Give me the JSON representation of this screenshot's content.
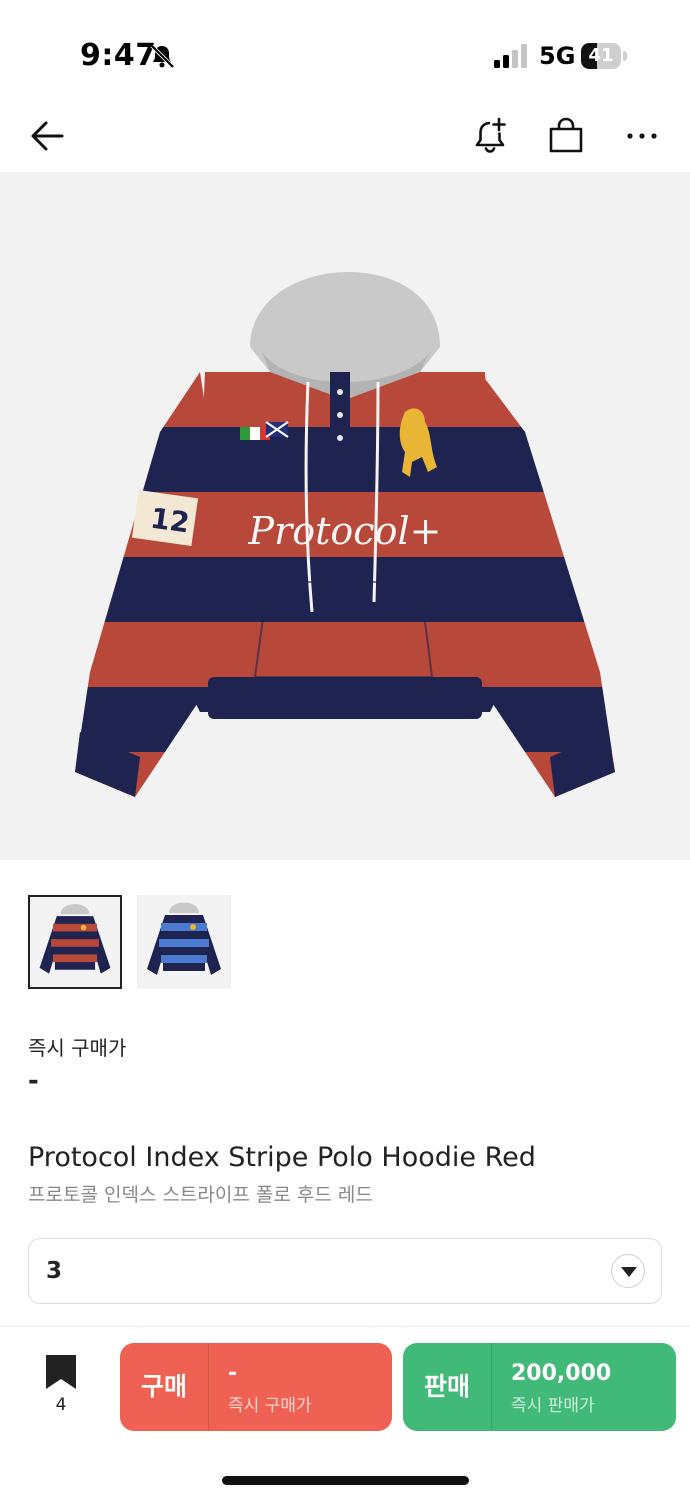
{
  "status_bar": {
    "time": "9:47",
    "network": "5G",
    "battery_level": "41",
    "battery_fraction": 0.41
  },
  "nav": {
    "icons": [
      "back-arrow-icon",
      "bell-plus-icon",
      "shopping-bag-icon",
      "more-dots-icon"
    ]
  },
  "product": {
    "main_image_subject": "red and navy striped hoodie",
    "thumbnails": [
      {
        "variant": "red",
        "selected": true
      },
      {
        "variant": "blue",
        "selected": false
      }
    ],
    "instant_buy_label": "즉시 구매가",
    "instant_buy_price": "-",
    "name_en": "Protocol Index Stripe Polo Hoodie Red",
    "name_ko": "프로토콜 인덱스 스트라이프 폴로 후드 레드",
    "size": "3"
  },
  "bottom_bar": {
    "bookmark_count": "4",
    "buy": {
      "label": "구매",
      "price": "-",
      "sub": "즉시 구매가"
    },
    "sell": {
      "label": "판매",
      "price": "200,000",
      "sub": "즉시 판매가"
    }
  },
  "colors": {
    "buy": "#ef6253",
    "sell": "#41b979",
    "hoodie_red": "#b8483a",
    "hoodie_navy": "#1f2350",
    "hoodie_blue": "#4b7bd1",
    "hood_gray": "#c9c9c9"
  },
  "image_text": {
    "logo": "Protocol+",
    "sleeve_number": "12"
  }
}
